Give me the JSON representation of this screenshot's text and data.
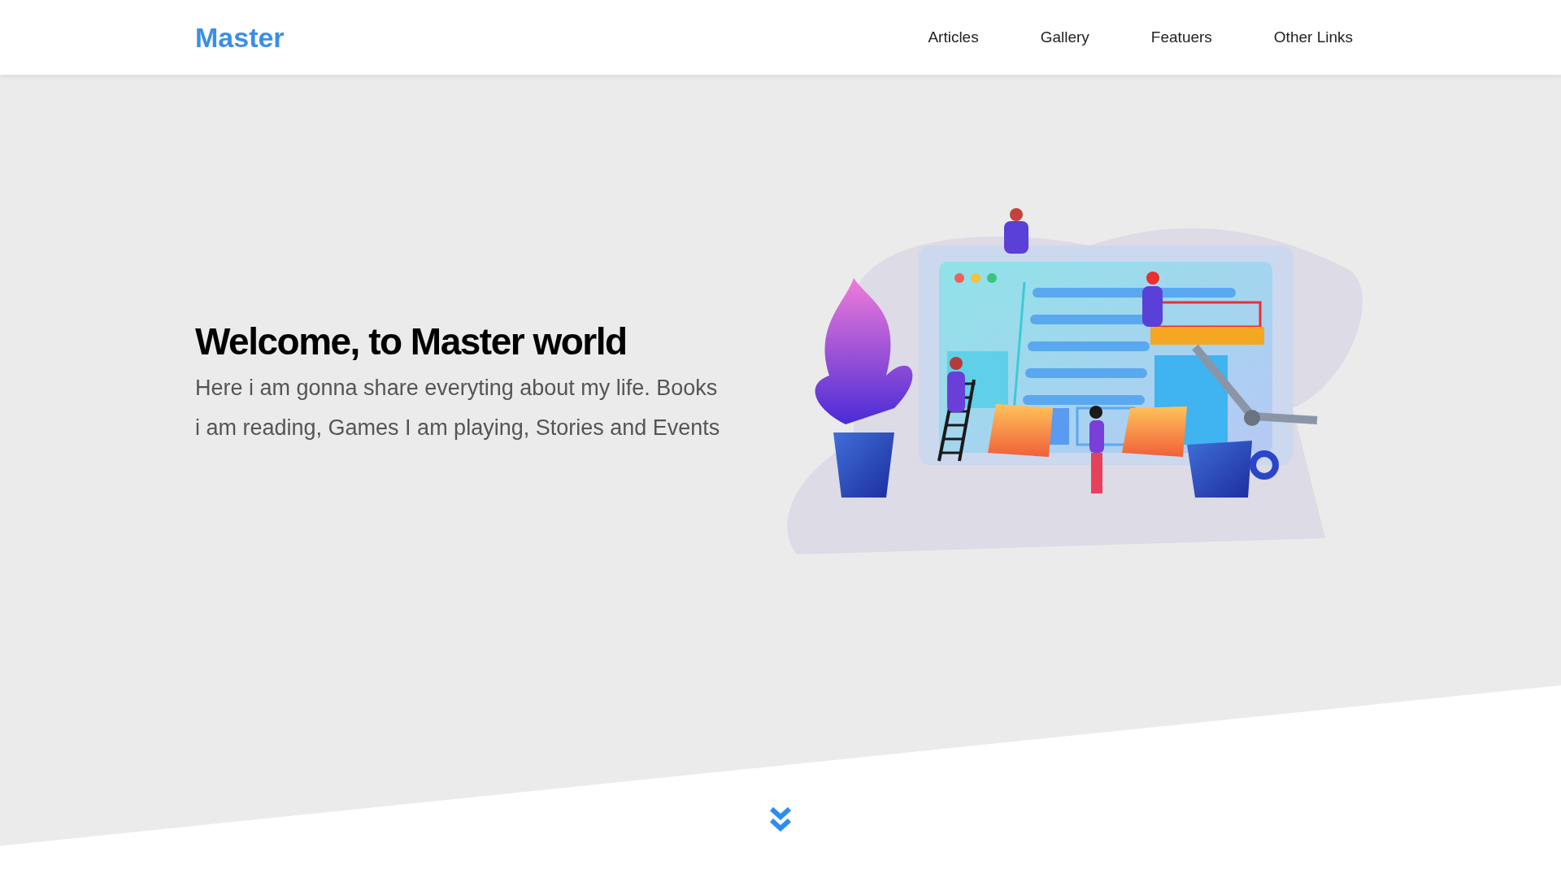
{
  "header": {
    "brand": "Master",
    "nav_links": [
      "Articles",
      "Gallery",
      "Featuers",
      "Other Links"
    ]
  },
  "hero": {
    "heading": "Welcome, to Master world",
    "text": "Here i am gonna share everyting about my life. Books i am reading, Games I am playing, Stories and Events"
  }
}
